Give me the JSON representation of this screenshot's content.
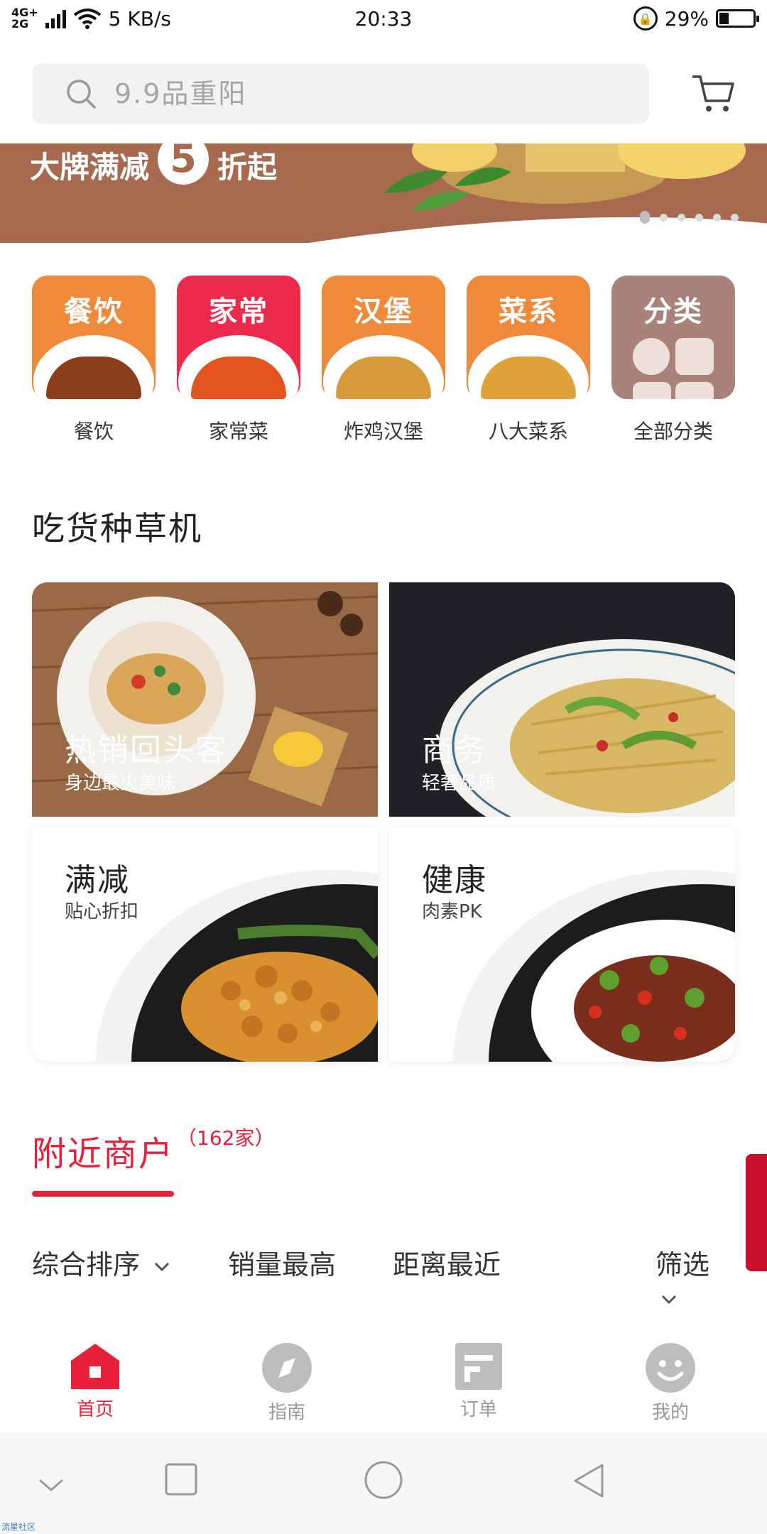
{
  "status_bar": {
    "network_type": "4G+ 2G",
    "speed": "5 KB/s",
    "time": "20:33",
    "battery": "29%",
    "battery_level": 0.29
  },
  "search": {
    "placeholder": "9.9品重阳"
  },
  "banner": {
    "text_left": "大牌满减",
    "number": "5",
    "text_right": "折起",
    "slide_count": 6,
    "active_slide": 1
  },
  "categories": [
    {
      "tag": "餐饮",
      "label": "餐饮",
      "color": "#f08a3b"
    },
    {
      "tag": "家常",
      "label": "家常菜",
      "color": "#ec2a4c"
    },
    {
      "tag": "汉堡",
      "label": "炸鸡汉堡",
      "color": "#f08a3b"
    },
    {
      "tag": "菜系",
      "label": "八大菜系",
      "color": "#f08a3b"
    },
    {
      "tag": "分类",
      "label": "全部分类",
      "color": "#a98379"
    }
  ],
  "section_title": "吃货种草机",
  "features": [
    {
      "title": "热销回头客",
      "subtitle": "身边最火美味"
    },
    {
      "title": "商务",
      "subtitle": "轻奢品质"
    },
    {
      "title": "满减",
      "subtitle": "贴心折扣"
    },
    {
      "title": "健康",
      "subtitle": "肉素PK"
    }
  ],
  "nearby": {
    "title": "附近商户",
    "count": "（162家）"
  },
  "sort": {
    "comprehensive": "综合排序",
    "sales": "销量最高",
    "distance": "距离最近",
    "filter": "筛选"
  },
  "bottom_nav": [
    {
      "label": "首页",
      "icon": "home-icon",
      "active": true
    },
    {
      "label": "指南",
      "icon": "compass-icon",
      "active": false
    },
    {
      "label": "订单",
      "icon": "order-icon",
      "active": false
    },
    {
      "label": "我的",
      "icon": "profile-icon",
      "active": false
    }
  ],
  "watermark": "流星社区",
  "colors": {
    "accent": "#e8203a",
    "banner": "#a86a4f",
    "orange_tile": "#f08a3b",
    "red_tile": "#ec2a4c",
    "mauve_tile": "#a98379"
  }
}
